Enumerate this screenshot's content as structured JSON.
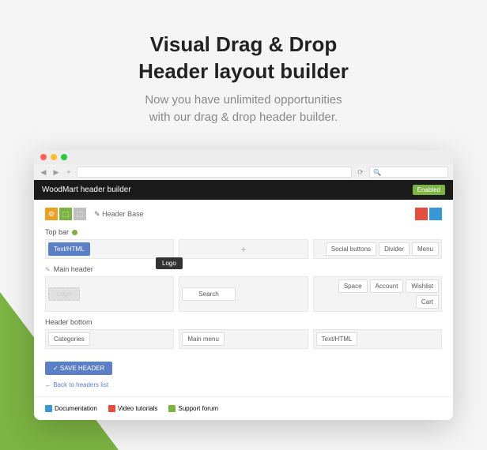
{
  "hero": {
    "title_line1": "Visual Drag & Drop",
    "title_line2": "Header layout builder",
    "sub_line1": "Now you have unlimited opportunities",
    "sub_line2": "with our drag & drop header builder."
  },
  "app": {
    "title": "WoodMart header builder",
    "enabled": "Enabled",
    "header_base": "Header Base",
    "edit_glyph": "✎"
  },
  "sections": {
    "topbar": {
      "label": "Top bar",
      "left": [
        "Text/HTML"
      ],
      "center_plus": "+",
      "right": [
        "Social buttons",
        "Divider",
        "Menu"
      ]
    },
    "main": {
      "label": "Main header",
      "drag_item": "Logo",
      "ghost": "Logo",
      "center": [
        "Search"
      ],
      "right": [
        "Space",
        "Account",
        "Wishlist",
        "Cart"
      ]
    },
    "bottom": {
      "label": "Header bottom",
      "left": [
        "Categories"
      ],
      "center": [
        "Main menu"
      ],
      "right": [
        "Text/HTML"
      ]
    }
  },
  "actions": {
    "save": "✓ SAVE HEADER",
    "back": "← Back to headers list"
  },
  "footer": {
    "doc": "Documentation",
    "video": "Video tutorials",
    "forum": "Support forum"
  },
  "search_placeholder": "🔍"
}
